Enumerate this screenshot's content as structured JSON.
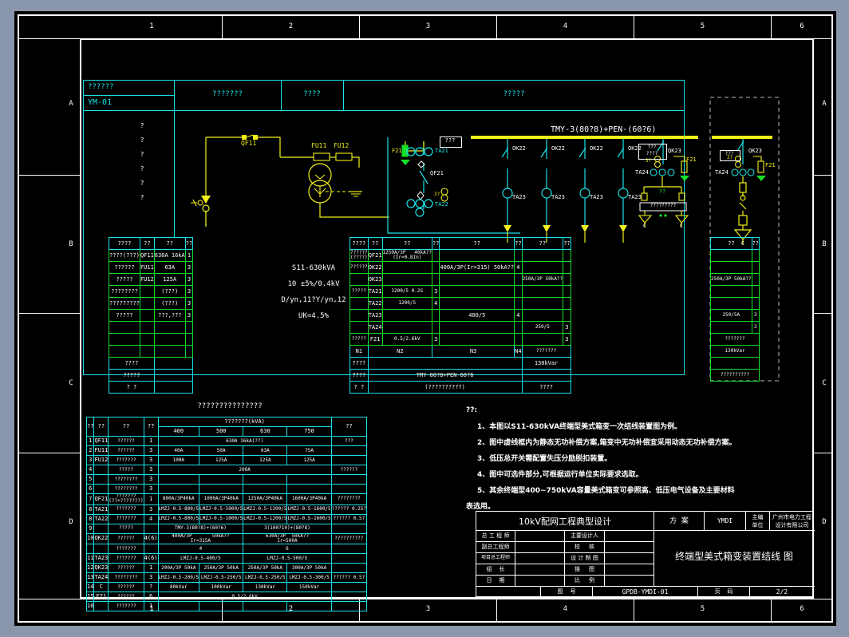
{
  "sheet": {
    "zone_numbers": [
      "1",
      "2",
      "3",
      "4",
      "5",
      "6"
    ],
    "zone_letters": [
      "A",
      "B",
      "C",
      "D"
    ]
  },
  "schematic": {
    "panel_headers": [
      {
        "label": "??????",
        "code": "YM-01"
      },
      {
        "label": "???????"
      },
      {
        "label": "????"
      },
      {
        "label": "?????"
      }
    ],
    "left_col_marks": [
      "?",
      "?",
      "?",
      "?",
      "?",
      "?"
    ],
    "hv_labels": {
      "qf11": "QF11",
      "fu11": "FU11",
      "fu12": "FU12"
    },
    "busbar_label": "TMY-3(80?8)+PEN-(60?6)",
    "incoming": {
      "f21": "F21",
      "ta21": "TA21",
      "qf21": "QF21",
      "ta22": "TA22",
      "note_box": "???",
      "deg": "3?"
    },
    "feeders": [
      {
        "switch": "OK22",
        "ct": "TA23"
      },
      {
        "switch": "OK22",
        "ct": "TA23"
      },
      {
        "switch": "OK22",
        "ct": "TA23"
      },
      {
        "switch": "OK22",
        "ct": "TA23"
      }
    ],
    "compensation": {
      "note_box": "???\n????",
      "qk23": "QK23",
      "deg": "3?",
      "ta24": "TA24",
      "f21": "F21",
      "coil_label": "??",
      "contactor_label": "?????????",
      "cap_label": "C",
      "dots": "oo"
    },
    "right_panel": {
      "qk23": "QK23",
      "deg": "3?",
      "ta24": "TA24",
      "f21": "F21",
      "note_box": "???",
      "cap_label": "C"
    }
  },
  "table_hv": {
    "headers": [
      "????",
      "??",
      "??",
      "??"
    ],
    "rows": [
      [
        "????(???)",
        "QF11",
        "630A   16kA",
        "1"
      ],
      [
        "??????",
        "FU11",
        "63A",
        "3"
      ],
      [
        "?????",
        "FU12",
        "125A",
        "3"
      ],
      [
        "????????",
        "",
        "(???)",
        "3"
      ],
      [
        "?????????",
        "",
        "(???)",
        "3"
      ],
      [
        "?????",
        "",
        "???,???",
        "3"
      ],
      [
        "",
        "",
        "",
        ""
      ],
      [
        "",
        "",
        "",
        ""
      ],
      [
        "",
        "",
        "",
        ""
      ]
    ],
    "footer": [
      [
        "????",
        ""
      ],
      [
        "?????",
        ""
      ],
      [
        "? ?",
        ""
      ]
    ],
    "side_marks": [
      "?",
      "?",
      "?",
      "?",
      "?",
      "?",
      "?",
      "?"
    ]
  },
  "transformer": {
    "lines": [
      "S11-630kVA",
      "10 ±5%/0.4kV",
      "D/yn,11?Y/yn,12",
      "UK=4.5%"
    ]
  },
  "table_lv": {
    "headers": [
      "????",
      "??",
      "??",
      "??",
      "??",
      "??",
      "??",
      "??"
    ],
    "group_labels": [
      "?",
      "?",
      "?",
      "?"
    ],
    "rows": [
      {
        "name": "??????\n(????)",
        "code": "QF21",
        "v1": "1250A/3P   40kA??\n(Ir=0.8In)",
        "n1": "",
        "v2": "",
        "n2": "",
        "v3": "",
        "n3": ""
      },
      {
        "name": "??????",
        "code": "OK22",
        "v1": "",
        "n1": "",
        "v2": "400A/3P(Ir=315)    50kA??",
        "n2": "4",
        "v3": "",
        "n3": ""
      },
      {
        "name": "",
        "code": "OK23",
        "v1": "",
        "n1": "",
        "v2": "",
        "n2": "",
        "v3": "250A/3P  50kA??",
        "n3": ""
      },
      {
        "name": "?????",
        "code": "TA21",
        "v1": "1200/5   0.2S",
        "n1": "3",
        "v2": "",
        "n2": "",
        "v3": "",
        "n3": ""
      },
      {
        "name": "",
        "code": "TA22",
        "v1": "1200/5",
        "n1": "4",
        "v2": "",
        "n2": "",
        "v3": "",
        "n3": ""
      },
      {
        "name": "",
        "code": "TA23",
        "v1": "",
        "n1": "",
        "v2": "400/5",
        "n2": "4",
        "v3": "",
        "n3": ""
      },
      {
        "name": "",
        "code": "TA24",
        "v1": "",
        "n1": "",
        "v2": "",
        "n2": "",
        "v3": "250/5",
        "n3": "3"
      },
      {
        "name": "?????",
        "code": "F21",
        "v1": "0.5/2.6kV",
        "n1": "3",
        "v2": "",
        "n2": "",
        "v3": "",
        "n3": "3"
      }
    ],
    "cabinet_row": [
      "N1",
      "N2",
      "N3",
      "N4",
      "???????"
    ],
    "footer": [
      [
        "????",
        "",
        "130kVar"
      ],
      [
        "????",
        "TMY-80?8+PEN-60?6",
        ""
      ],
      [
        "? ?",
        "(??????????)",
        "????"
      ]
    ]
  },
  "right_table": {
    "headers": [
      "??",
      "??"
    ],
    "rows": [
      [
        "",
        ""
      ],
      [
        "",
        ""
      ],
      [
        "250A/3P  50kA??",
        ""
      ],
      [
        "",
        ""
      ],
      [
        "",
        ""
      ],
      [
        "250/5A",
        "3"
      ],
      [
        "",
        "3"
      ]
    ],
    "footer": [
      "???????",
      "130kVar",
      "",
      "??????????"
    ]
  },
  "material_table": {
    "title": "???????????????",
    "headers": {
      "no": "??",
      "code": "??",
      "name": "??",
      "qty": "??",
      "capacity_group": "???????(kVA)",
      "capacities": [
        "400",
        "500",
        "630",
        "750"
      ],
      "remark": "??"
    },
    "rows": [
      {
        "no": "1",
        "code": "QF11",
        "name": "??????",
        "qty": "1",
        "c400": "",
        "c500": "630A      16kA(??)",
        "c630": "",
        "c750": "",
        "remark": "???",
        "span": "merge_mid"
      },
      {
        "no": "2",
        "code": "FU11",
        "name": "??????",
        "qty": "3",
        "c400": "40A",
        "c500": "50A",
        "c630": "63A",
        "c750": "75A",
        "remark": ""
      },
      {
        "no": "3",
        "code": "FU12",
        "name": "???????",
        "qty": "3",
        "c400": "100A",
        "c500": "125A",
        "c630": "125A",
        "c750": "125A",
        "remark": ""
      },
      {
        "no": "4",
        "code": "",
        "name": "?????",
        "qty": "3",
        "c400": "200A",
        "c500": "",
        "c630": "",
        "c750": "",
        "remark": "??????",
        "span": "all"
      },
      {
        "no": "5",
        "code": "",
        "name": "????????",
        "qty": "3",
        "c400": "",
        "c500": "",
        "c630": "",
        "c750": "",
        "remark": ""
      },
      {
        "no": "6",
        "code": "",
        "name": "????????",
        "qty": "3",
        "c400": "",
        "c500": "",
        "c630": "",
        "c750": "",
        "remark": ""
      },
      {
        "no": "7",
        "code": "QF21",
        "name": "???????\n(??+???????)",
        "qty": "1",
        "c400": "800A/3P40kA",
        "c500": "1000A/3P40kA",
        "c630": "1250A/3P40kA",
        "c750": "1600A/3P40kA",
        "sub": "Ir=0.8In",
        "remark": "????????"
      },
      {
        "no": "8",
        "code": "TA21",
        "name": "???????",
        "qty": "3",
        "c400": "LMZJ-0.5-800/5",
        "c500": "LMZJ-0.5-1000/5",
        "c630": "LMZJ-0.5-1200/5",
        "c750": "LMZJ-0.5-1600/5",
        "remark": "?????? 0.2S?"
      },
      {
        "no": "8",
        "code": "TA22",
        "name": "???????",
        "qty": "4",
        "c400": "LMZJ-0.5-800/5",
        "c500": "LMZJ-0.5-1000/5",
        "c630": "LMZJ-0.5-1200/5",
        "c750": "LMZJ-0.5-1600/5",
        "remark": "?????? 0.5?"
      },
      {
        "no": "9",
        "code": "",
        "name": "?????",
        "qty": "",
        "c400": "TMY-3(80?8)+(60?6)",
        "c500": "",
        "c630": "3(100?10)+(80?8)",
        "c750": "",
        "remark": "",
        "span": "pair"
      },
      {
        "no": "10",
        "code": "QK22",
        "name": "??????",
        "qty": "4(6)",
        "c400": "400A/3P       50kA??\nIr=315A",
        "c500": "",
        "c630": "630A/3P  50kA??\nIr=500A",
        "c750": "",
        "remark": "??????????",
        "span": "pair"
      },
      {
        "no": "",
        "code": "",
        "name": "???????",
        "qty": "",
        "c400": "4",
        "c500": "",
        "c630": "6",
        "c750": "",
        "remark": "",
        "span": "pair"
      },
      {
        "no": "11",
        "code": "TA23",
        "name": "???????",
        "qty": "4(6)",
        "c400": "LMZJ-0.5-400/5",
        "c500": "",
        "c630": "LMZJ-0.5-500/5",
        "c750": "",
        "remark": "",
        "span": "pair"
      },
      {
        "no": "12",
        "code": "QK23",
        "name": "??????",
        "qty": "1",
        "c400": "200A/3P 50kA",
        "c500": "250A/3P 50kA",
        "c630": "250A/3P 50kA",
        "c750": "300A/3P 50kA",
        "remark": ""
      },
      {
        "no": "13",
        "code": "TA24",
        "name": "????????",
        "qty": "3",
        "c400": "LMZJ-0.5-200/5",
        "c500": "LMZJ-0.5-250/5",
        "c630": "LMZJ-0.5-250/5",
        "c750": "LMZJ-0.5-300/5",
        "remark": "?????? 0.5?"
      },
      {
        "no": "14",
        "code": "C",
        "name": "??????",
        "qty": "?",
        "c400": "80kVar",
        "c500": "100kVar",
        "c630": "130kVar",
        "c750": "150kVar",
        "remark": ""
      },
      {
        "no": "15",
        "code": "F21",
        "name": "??????",
        "qty": "6",
        "c400": "0.5/2.6kV",
        "c500": "",
        "c630": "",
        "c750": "",
        "remark": "",
        "span": "all"
      },
      {
        "no": "16",
        "code": "",
        "name": "???????",
        "qty": "1",
        "c400": "",
        "c500": "",
        "c630": "",
        "c750": "",
        "remark": ""
      }
    ]
  },
  "notes": {
    "title": "??:",
    "items": [
      "1、本图以S11-630kVA终端型美式箱变一次结线装置图为例。",
      "2、图中虚线框内为静态无功补偿方案,箱变中无功补偿宜采用动态无功补偿方案。",
      "3、低压总开关需配置失压分励脱扣装置。",
      "4、图中可选件部分,可根据运行单位实际要求选取。",
      "5、其余终端型400~750kVA容量美式箱变可参照高、低压电气设备及主要材料",
      "表选用。"
    ]
  },
  "title_block": {
    "main_title": "10kV配网工程典型设计",
    "scheme_label": "方  案",
    "scheme_value": "YMDI",
    "unit_label": "主编\n单位",
    "unit_value": "广州市电力工程\n设计有限公司",
    "left_rows": [
      {
        "label": "总 工 程 师",
        "value": ""
      },
      {
        "label": "副总工程师",
        "value": ""
      },
      {
        "label": "项目总工程师",
        "value": ""
      },
      {
        "label": "组    长",
        "value": ""
      },
      {
        "label": "日    期",
        "value": ""
      }
    ],
    "mid_rows": [
      {
        "label": "主要设计人",
        "value": ""
      },
      {
        "label": "校     核",
        "value": ""
      },
      {
        "label": "设 计 制 图",
        "value": ""
      },
      {
        "label": "描     图",
        "value": ""
      },
      {
        "label": "比     例",
        "value": ""
      }
    ],
    "drawing_title": "终端型美式箱变装置结线 图",
    "dwg_no_label": "图    号",
    "dwg_no_value": "GPDB-YMDI-01",
    "page_label": "页    码",
    "page_value": "2/2"
  }
}
